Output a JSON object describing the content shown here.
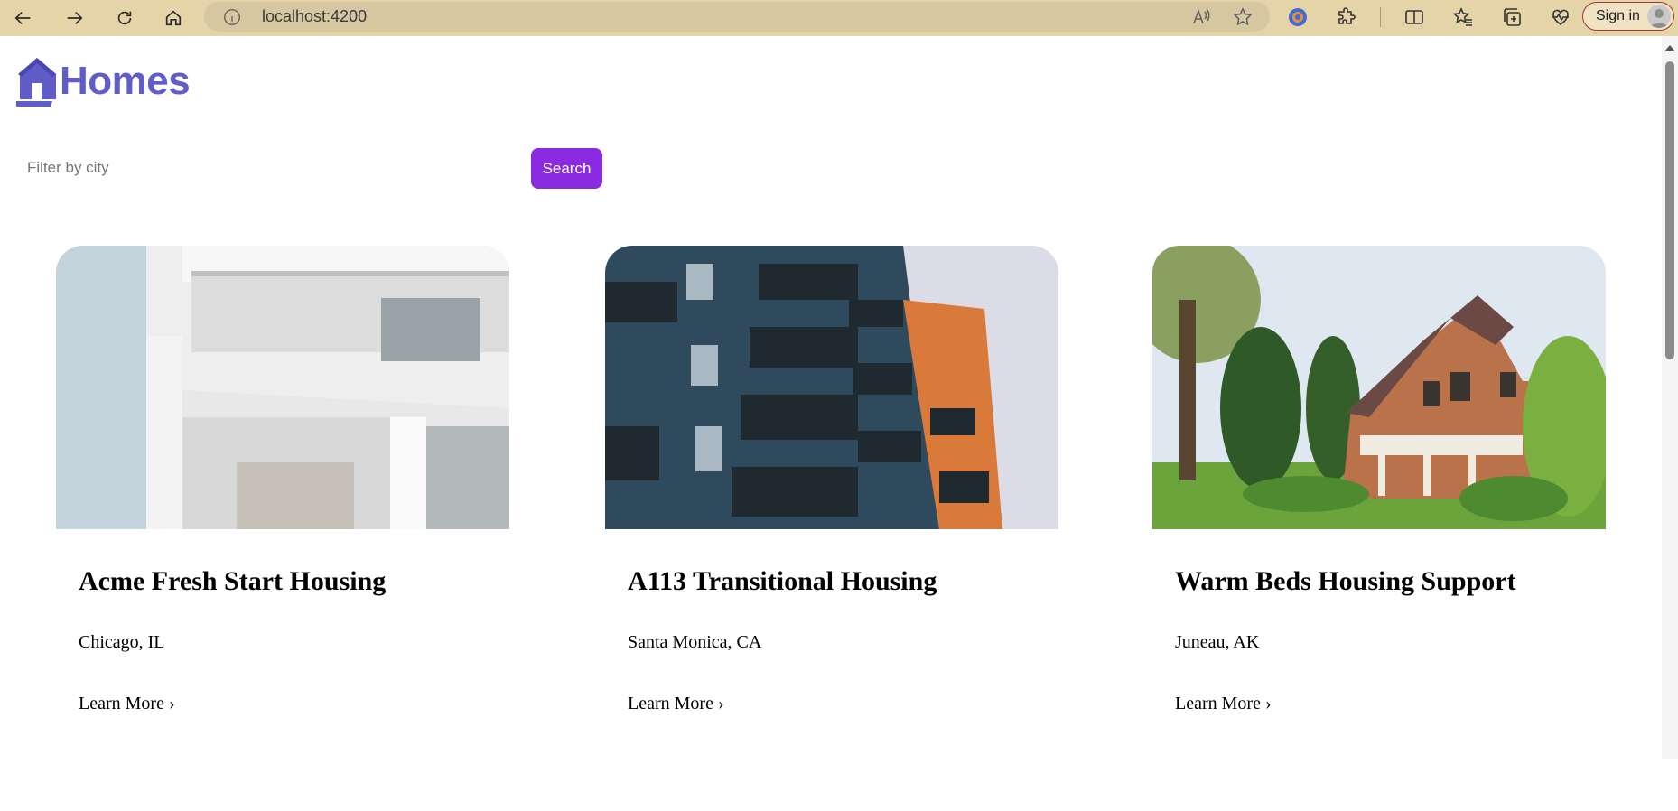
{
  "browser": {
    "url": "localhost:4200",
    "sign_in_label": "Sign in"
  },
  "icons": {
    "back": "back-arrow-icon",
    "forward": "forward-arrow-icon",
    "refresh": "refresh-icon",
    "home": "home-icon",
    "info": "info-icon",
    "read_aloud": "read-aloud-icon",
    "favorite": "star-icon",
    "extensions": "puzzle-icon",
    "split": "split-screen-icon",
    "favorites": "favorites-icon",
    "collections": "collections-icon",
    "health": "heart-pulse-icon"
  },
  "header": {
    "brand": "Homes",
    "brand_color": "#605DC8"
  },
  "search": {
    "placeholder": "Filter by city",
    "button_label": "Search",
    "button_color": "#8A2BE2"
  },
  "listings": [
    {
      "name": "Acme Fresh Start Housing",
      "location": "Chicago, IL",
      "link": "Learn More ›"
    },
    {
      "name": "A113 Transitional Housing",
      "location": "Santa Monica, CA",
      "link": "Learn More ›"
    },
    {
      "name": "Warm Beds Housing Support",
      "location": "Juneau, AK",
      "link": "Learn More ›"
    }
  ]
}
